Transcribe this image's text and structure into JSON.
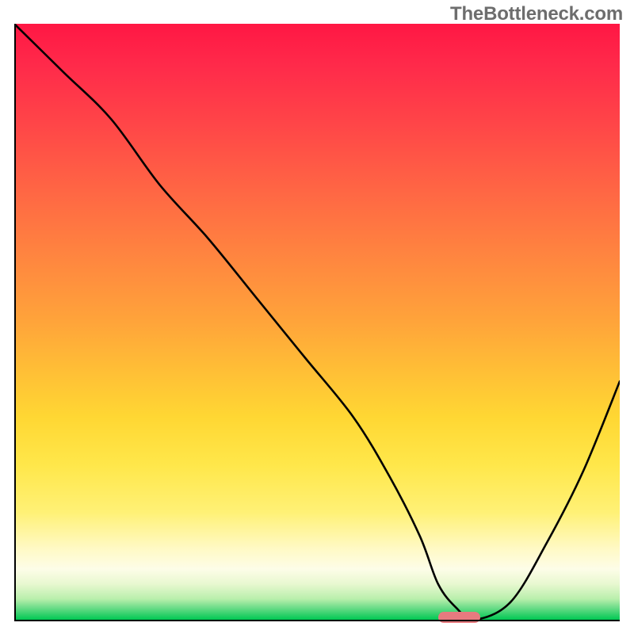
{
  "watermark": "TheBottleneck.com",
  "chart_data": {
    "type": "line",
    "title": "",
    "xlabel": "",
    "ylabel": "",
    "xlim": [
      0,
      100
    ],
    "ylim": [
      0,
      100
    ],
    "grid": false,
    "legend": false,
    "background_gradient": {
      "direction": "vertical",
      "stops": [
        {
          "pos": 0,
          "color": "#ff1744"
        },
        {
          "pos": 50,
          "color": "#ffa43a"
        },
        {
          "pos": 82,
          "color": "#fff176"
        },
        {
          "pos": 94,
          "color": "#e8f8d0"
        },
        {
          "pos": 100,
          "color": "#00c853"
        }
      ]
    },
    "series": [
      {
        "name": "bottleneck-curve",
        "color": "#000000",
        "x": [
          0,
          8,
          16,
          24,
          32,
          40,
          48,
          56,
          62,
          67,
          70,
          73,
          76,
          82,
          88,
          94,
          100
        ],
        "y": [
          100,
          92,
          84,
          73,
          64,
          54,
          44,
          34,
          24,
          14,
          6,
          2,
          0,
          3,
          13,
          25,
          40
        ]
      }
    ],
    "marker": {
      "name": "optimal-range",
      "color": "#e77a7f",
      "x_start": 70,
      "x_end": 77,
      "y": 0
    }
  }
}
